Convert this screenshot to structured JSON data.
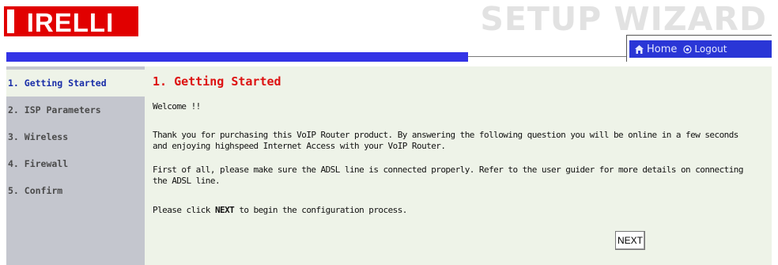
{
  "brand": {
    "logo_text": "PIRELLI",
    "logo_color": "#e10000"
  },
  "header": {
    "wizard_title": "SETUP WIZARD",
    "bar_color": "#3333e6"
  },
  "nav": {
    "home_label": "Home",
    "logout_label": "Logout"
  },
  "sidebar": {
    "items": [
      {
        "label": "1. Getting Started",
        "active": true
      },
      {
        "label": "2. ISP Parameters",
        "active": false
      },
      {
        "label": "3. Wireless",
        "active": false
      },
      {
        "label": "4. Firewall",
        "active": false
      },
      {
        "label": "5. Confirm",
        "active": false
      }
    ]
  },
  "main": {
    "title": "1. Getting Started",
    "welcome": "Welcome !!",
    "thanks": "Thank you for purchasing this VoIP Router product. By answering the following question you will be online in a few seconds and enjoying highspeed Internet Access with your VoIP Router.",
    "first": "First of all, please make sure the ADSL line is connected properly. Refer to the user guider for more details on connecting the ADSL line.",
    "click_before": "Please click ",
    "click_bold": "NEXT",
    "click_after": " to begin the configuration process.",
    "next_label": "NEXT"
  }
}
